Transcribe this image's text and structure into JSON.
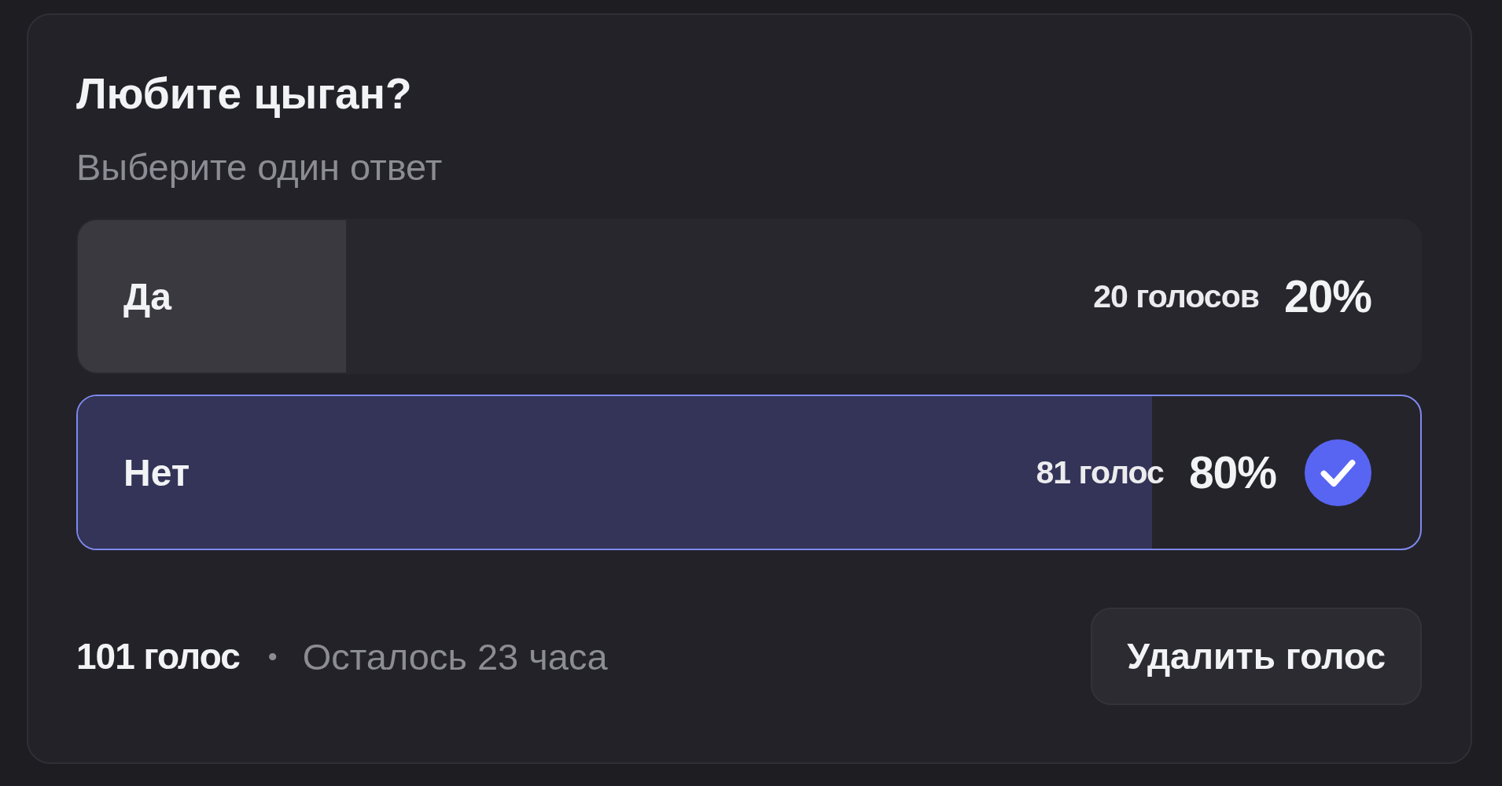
{
  "poll": {
    "question": "Любите цыган?",
    "hint": "Выберите один ответ",
    "answers": [
      {
        "label": "Да",
        "votes": "20 голосов",
        "percent": "20%",
        "level": 0.2,
        "selected": false
      },
      {
        "label": "Нет",
        "votes": "81 голос",
        "percent": "80%",
        "level": 0.8,
        "selected": true
      }
    ],
    "footer": {
      "total": "101 голос",
      "separator": "•",
      "time_left": "Осталось 23 часа"
    },
    "button": "Удалить голос"
  }
}
